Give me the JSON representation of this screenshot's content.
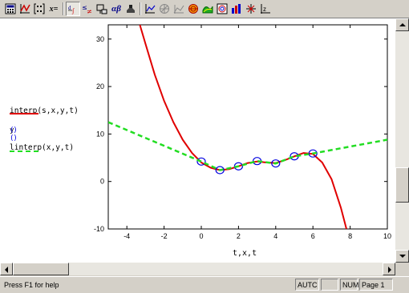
{
  "toolbar": {
    "buttons": [
      {
        "name": "calculator-toolbar-icon",
        "active": false
      },
      {
        "name": "graph-toolbar-icon",
        "active": false
      },
      {
        "name": "matrix-toolbar-icon",
        "active": false
      },
      {
        "name": "evaluation-toolbar-icon",
        "active": false
      },
      {
        "name": "calculus-toolbar-icon",
        "active": true
      },
      {
        "name": "boolean-toolbar-icon",
        "active": false
      },
      {
        "name": "programming-toolbar-icon",
        "active": false
      },
      {
        "name": "greek-toolbar-icon",
        "active": false
      },
      {
        "name": "symbolic-toolbar-icon",
        "active": false
      },
      {
        "name": "xy-plot-icon",
        "active": false
      },
      {
        "name": "polar-plot-icon",
        "active": false
      },
      {
        "name": "surface-plot-icon",
        "active": false
      },
      {
        "name": "contour-plot-icon",
        "active": false
      },
      {
        "name": "3d-scatter-icon",
        "active": false
      },
      {
        "name": "3d-bar-icon",
        "active": false
      },
      {
        "name": "vector-field-icon",
        "active": false
      },
      {
        "name": "zoom-icon",
        "active": false
      },
      {
        "name": "trace-icon",
        "active": false
      }
    ],
    "eval_label": "x="
  },
  "legend": {
    "entry1": "interp(s,x,y,t)",
    "entry2": "y",
    "entry2_markers": "()()",
    "entry3": "linterp(x,y,t)",
    "colors": {
      "red": "#e00000",
      "blue": "#0000e0",
      "green": "#22dd22"
    }
  },
  "chart_data": {
    "type": "line",
    "xlabel": "t,x,t",
    "ylabel": "",
    "xlim": [
      -5,
      10
    ],
    "ylim": [
      -10,
      33
    ],
    "x_ticks": [
      "-4",
      "-2",
      "0",
      "2",
      "4",
      "6",
      "8",
      "10"
    ],
    "y_ticks": [
      "30",
      "20",
      "10",
      "0",
      "-10"
    ],
    "series": [
      {
        "name": "interp(s,x,y,t)",
        "style": "solid",
        "color": "#e00000",
        "x": [
          -3.3,
          -3,
          -2.5,
          -2,
          -1.5,
          -1,
          -0.5,
          0,
          0.5,
          1,
          1.5,
          2,
          2.5,
          3,
          3.5,
          4,
          4.5,
          5,
          5.5,
          6,
          6.5,
          7,
          7.5,
          7.8
        ],
        "y": [
          33,
          29,
          22.5,
          17,
          12.5,
          8.8,
          6,
          4,
          2.9,
          2.4,
          2.6,
          3.2,
          3.9,
          4.2,
          4.0,
          3.9,
          4.5,
          5.3,
          6.0,
          5.8,
          4.0,
          0.5,
          -5.5,
          -10
        ]
      },
      {
        "name": "y",
        "style": "markers",
        "color": "#0000e0",
        "x": [
          0,
          1,
          2,
          3,
          4,
          5,
          6
        ],
        "y": [
          4.2,
          2.4,
          3.2,
          4.3,
          3.8,
          5.3,
          5.9
        ]
      },
      {
        "name": "linterp(x,y,t)",
        "style": "dashed",
        "color": "#22dd22",
        "x": [
          -5,
          0,
          1,
          2,
          3,
          4,
          5,
          6,
          10
        ],
        "y": [
          12.5,
          4.2,
          2.4,
          3.2,
          4.3,
          3.8,
          5.3,
          5.9,
          8.8
        ]
      }
    ]
  },
  "status": {
    "help": "Press F1 for help",
    "auto": "AUTC",
    "num": "NUM",
    "page": "Page 1"
  }
}
